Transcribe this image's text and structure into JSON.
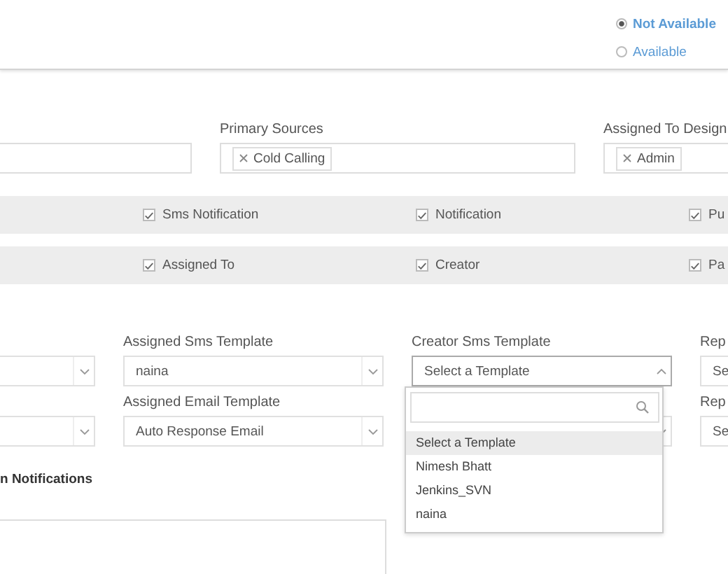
{
  "availability": [
    {
      "label": "Not Available",
      "selected": true
    },
    {
      "label": "Available",
      "selected": false
    }
  ],
  "sources": [
    {
      "kind": "tags"
    },
    {
      "kind": "tags",
      "label": "Primary Sources",
      "values": [
        "Cold Calling"
      ]
    },
    {
      "kind": "tags",
      "label": "Assigned To Design",
      "values": [
        "Admin"
      ]
    }
  ],
  "notify_rows": [
    [
      {
        "label": "Sms Notification",
        "checked": true
      },
      {
        "label": "Notification",
        "checked": true
      },
      {
        "label": "Pu",
        "checked": true
      }
    ],
    [
      {
        "label": "Assigned To",
        "checked": true
      },
      {
        "label": "Creator",
        "checked": true
      },
      {
        "label": "Pa",
        "checked": true
      }
    ]
  ],
  "templates": [
    [
      {
        "expanded": false
      },
      {
        "label": "Assigned Sms Template",
        "value": "naina",
        "expanded": false
      },
      {
        "label": "Creator Sms Template",
        "value": "Select a Template",
        "expanded": true,
        "options": [
          {
            "label": "Select a Template",
            "selected": true
          },
          {
            "label": "Nimesh Bhatt",
            "selected": false
          },
          {
            "label": "Jenkins_SVN",
            "selected": false
          },
          {
            "label": "naina",
            "selected": false
          }
        ]
      },
      {
        "label": "Rep",
        "value": "Se",
        "expanded": false
      }
    ],
    [
      {
        "expanded": false
      },
      {
        "label": "Assigned Email Template",
        "value": "Auto Response Email",
        "expanded": false
      },
      {
        "expanded": false
      },
      {
        "label": "Rep",
        "value": "Se",
        "expanded": false
      }
    ]
  ],
  "section_title": "n Notifications"
}
